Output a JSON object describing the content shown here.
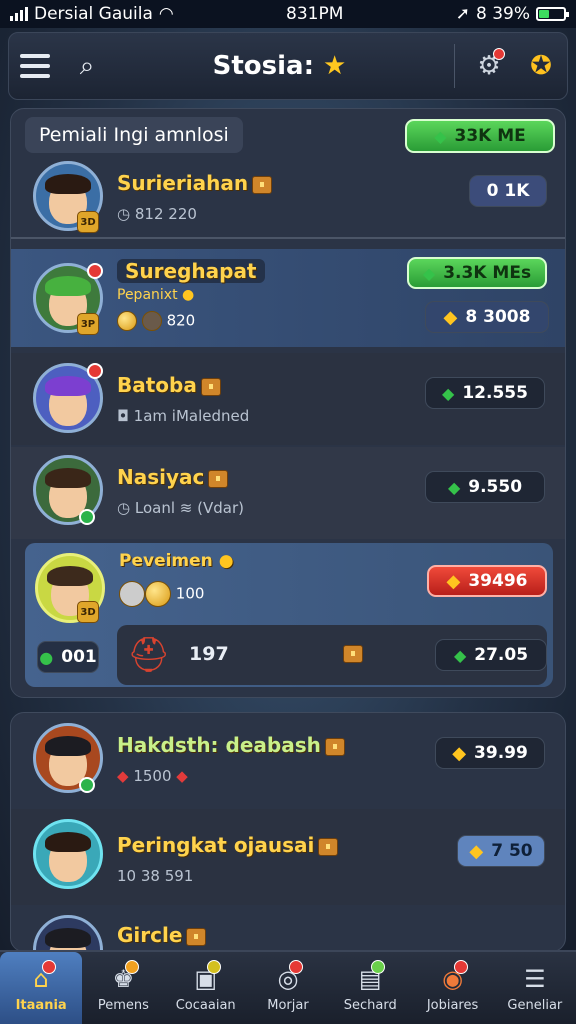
{
  "status_bar": {
    "carrier": "Dersial Gauila",
    "time": "831PM",
    "battery": "8 39%",
    "battery_level": 0.39
  },
  "header": {
    "title": "Stosia:",
    "title_star": "★"
  },
  "panel": {
    "rank_label": "Pemiali Ingi amnlosi",
    "rank_pill": "33K ME",
    "rows": [
      {
        "name": "Surieriahan",
        "sub": "812 220",
        "pill": "0 1K",
        "level": "3D"
      },
      {
        "name": "Sureghapat",
        "sub_label": "Pepanixt",
        "sub": "820",
        "pill_top": "3.3K MEs",
        "pill": "8 3008",
        "level": "3P"
      },
      {
        "name": "Batoba",
        "sub": "1am iMaledned",
        "pill": "12.555"
      },
      {
        "name": "Nasiyac",
        "sub": "Loanl",
        "sub2": "(Vdar)",
        "pill": "9.550"
      },
      {
        "name": "Peveimen",
        "sub": "100",
        "pill": "39496",
        "level": "3D"
      }
    ],
    "sub_row": {
      "score": "197",
      "left_pill": "001",
      "pill": "27.05"
    }
  },
  "panel2": {
    "rows": [
      {
        "name": "Hakdsth: deabash",
        "sub": "1500",
        "pill": "39.99"
      },
      {
        "name": "Peringkat ojausai",
        "sub": "10 38 591",
        "pill": "7 50"
      },
      {
        "name": "Gircle",
        "pill": ""
      }
    ]
  },
  "bottom_nav": [
    {
      "label": "Itaania",
      "icon": "home-icon"
    },
    {
      "label": "Pemens",
      "icon": "trophy-icon"
    },
    {
      "label": "Cocaaian",
      "icon": "shop-icon"
    },
    {
      "label": "Morjar",
      "icon": "target-icon"
    },
    {
      "label": "Sechard",
      "icon": "inventory-icon"
    },
    {
      "label": "Jobiares",
      "icon": "missions-icon"
    },
    {
      "label": "Geneliar",
      "icon": "more-icon"
    }
  ]
}
